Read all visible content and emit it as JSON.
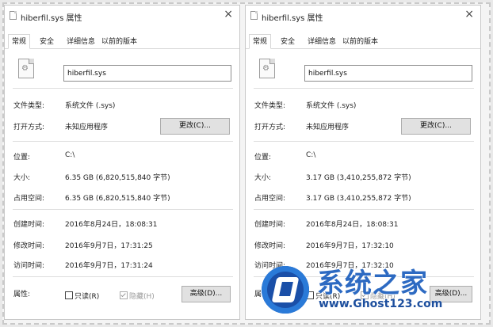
{
  "left": {
    "title": "hiberfil.sys 属性",
    "close_glyph": "×",
    "tabs": [
      "常规",
      "安全",
      "详细信息",
      "以前的版本"
    ],
    "filename": "hiberfil.sys",
    "rows": {
      "type_label": "文件类型:",
      "type_value": "系统文件 (.sys)",
      "open_label": "打开方式:",
      "open_value": "未知应用程序",
      "change_button": "更改(C)...",
      "location_label": "位置:",
      "location_value": "C:\\",
      "size_label": "大小:",
      "size_value": "6.35 GB (6,820,515,840 字节)",
      "disk_label": "占用空间:",
      "disk_value": "6.35 GB (6,820,515,840 字节)",
      "created_label": "创建时间:",
      "created_value": "2016年8月24日，18:08:31",
      "modified_label": "修改时间:",
      "modified_value": "2016年9月7日，17:31:25",
      "accessed_label": "访问时间:",
      "accessed_value": "2016年9月7日，17:31:24",
      "attr_label": "属性:",
      "readonly": "只读(R)",
      "hidden": "隐藏(H)",
      "advanced_button": "高级(D)..."
    }
  },
  "right": {
    "title": "hiberfil.sys 属性",
    "close_glyph": "×",
    "tabs": [
      "常规",
      "安全",
      "详细信息",
      "以前的版本"
    ],
    "filename": "hiberfil.sys",
    "rows": {
      "type_label": "文件类型:",
      "type_value": "系统文件 (.sys)",
      "open_label": "打开方式:",
      "open_value": "未知应用程序",
      "change_button": "更改(C)...",
      "location_label": "位置:",
      "location_value": "C:\\",
      "size_label": "大小:",
      "size_value": "3.17 GB (3,410,255,872 字节)",
      "disk_label": "占用空间:",
      "disk_value": "3.17 GB (3,410,255,872 字节)",
      "created_label": "创建时间:",
      "created_value": "2016年8月24日，18:08:31",
      "modified_label": "修改时间:",
      "modified_value": "2016年9月7日，17:32:10",
      "accessed_label": "访问时间:",
      "accessed_value": "2016年9月7日，17:32:10",
      "attr_label": "属性:",
      "readonly": "只读(R)",
      "hidden": "隐藏(H)",
      "advanced_button": "高级(D)..."
    }
  },
  "watermark": {
    "brand": "系统之家",
    "url": "www.Ghost123.com"
  },
  "colors": {
    "watermark_blue": "#2d6ac2",
    "dialog_bg": "#ffffff",
    "button_bg": "#e1e1e1"
  },
  "icons": [
    "file-icon",
    "close-icon",
    "checkbox-icon",
    "watermark-logo-icon"
  ]
}
